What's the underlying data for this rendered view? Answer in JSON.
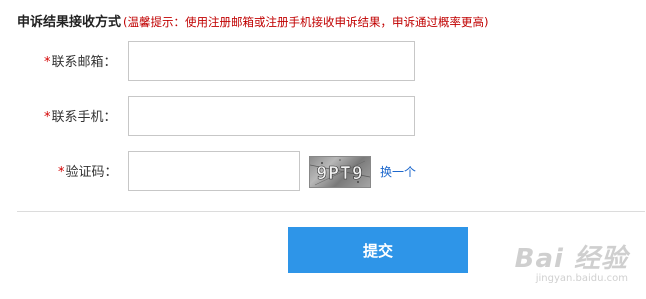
{
  "section": {
    "title": "申诉结果接收方式",
    "hint": "(温馨提示：使用注册邮箱或注册手机接收申诉结果，申诉通过概率更高)"
  },
  "form": {
    "required_mark": "*",
    "email_label": "联系邮箱：",
    "email_value": "",
    "phone_label": "联系手机：",
    "phone_value": "",
    "captcha_label": "验证码：",
    "captcha_value": "",
    "captcha_text": "9PT9",
    "change_captcha_label": "换一个"
  },
  "actions": {
    "submit_label": "提交"
  },
  "watermark": {
    "main": "Bai 经验",
    "sub": "jingyan.baidu.com"
  },
  "colors": {
    "hint": "#c00000",
    "required": "#d40000",
    "link": "#1a66cc",
    "submit_bg": "#2e95e8",
    "input_border": "#c7c7c7"
  }
}
